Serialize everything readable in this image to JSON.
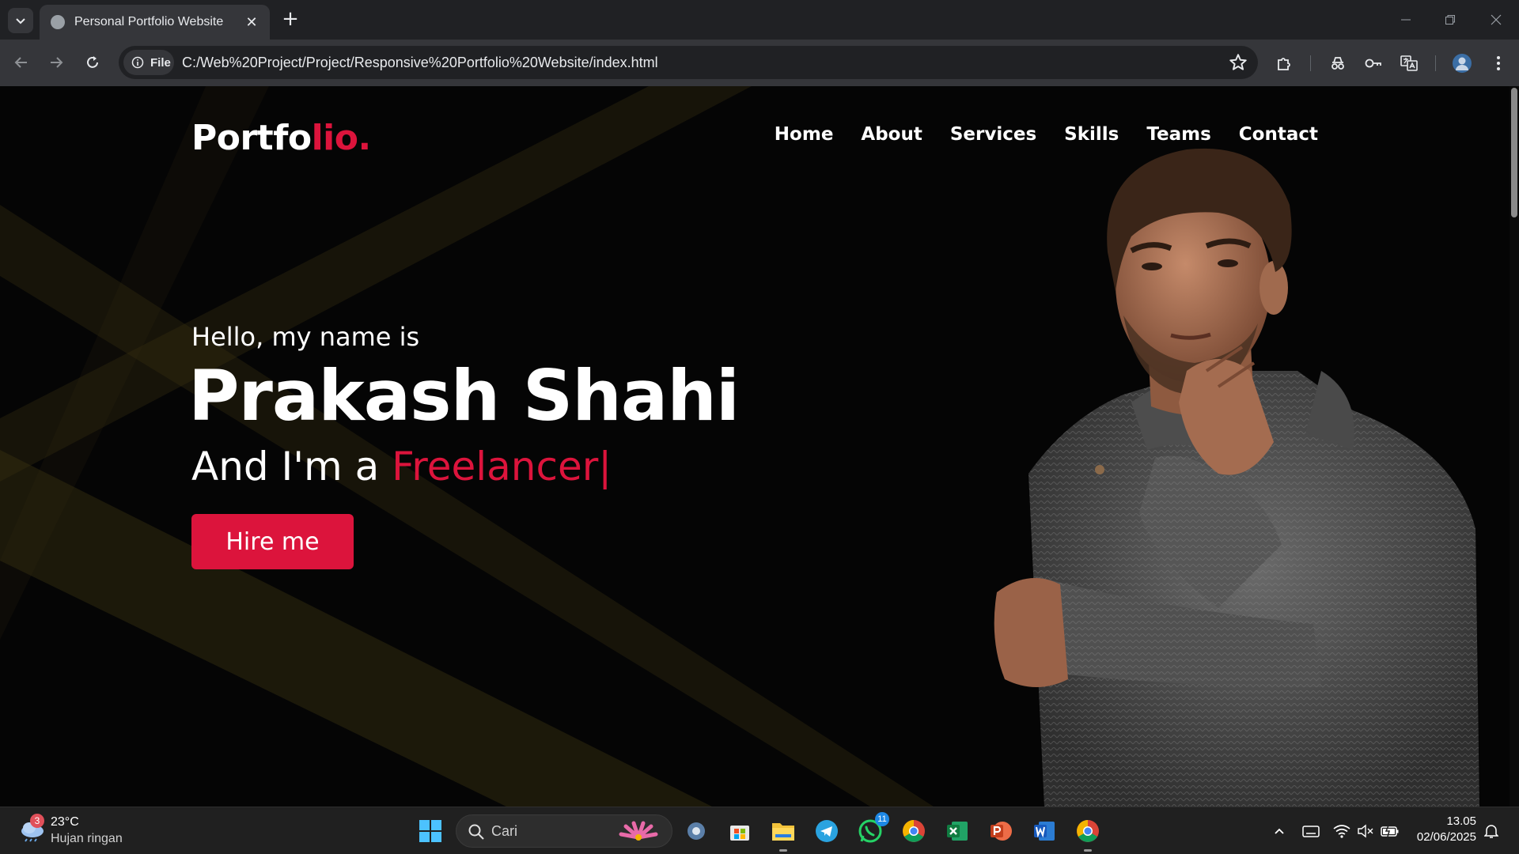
{
  "browser": {
    "tab_title": "Personal Portfolio Website",
    "tab_close": "✕",
    "new_tab": "+",
    "site_info_label": "File",
    "url": "C:/Web%20Project/Project/Responsive%20Portfolio%20Website/index.html"
  },
  "site": {
    "logo_main": "Portfo",
    "logo_accent": "lio.",
    "nav": [
      "Home",
      "About",
      "Services",
      "Skills",
      "Teams",
      "Contact"
    ],
    "hello": "Hello, my name is",
    "name": "Prakash Shahi",
    "role_prefix": "And I'm a ",
    "role_typed": "Freelancer",
    "typing_cursor": "|",
    "hire_button": "Hire me",
    "accent_color": "#dc143c"
  },
  "taskbar": {
    "weather_badge": "3",
    "temperature": "23°C",
    "weather_condition": "Hujan ringan",
    "search_placeholder": "Cari",
    "whatsapp_badge": "11",
    "time": "13.05",
    "date": "02/06/2025",
    "apps": [
      "settings-icon",
      "store-icon",
      "file-explorer-icon",
      "telegram-icon",
      "whatsapp-icon",
      "chrome-icon",
      "excel-icon",
      "powerpoint-icon",
      "word-icon",
      "chrome-icon"
    ]
  }
}
